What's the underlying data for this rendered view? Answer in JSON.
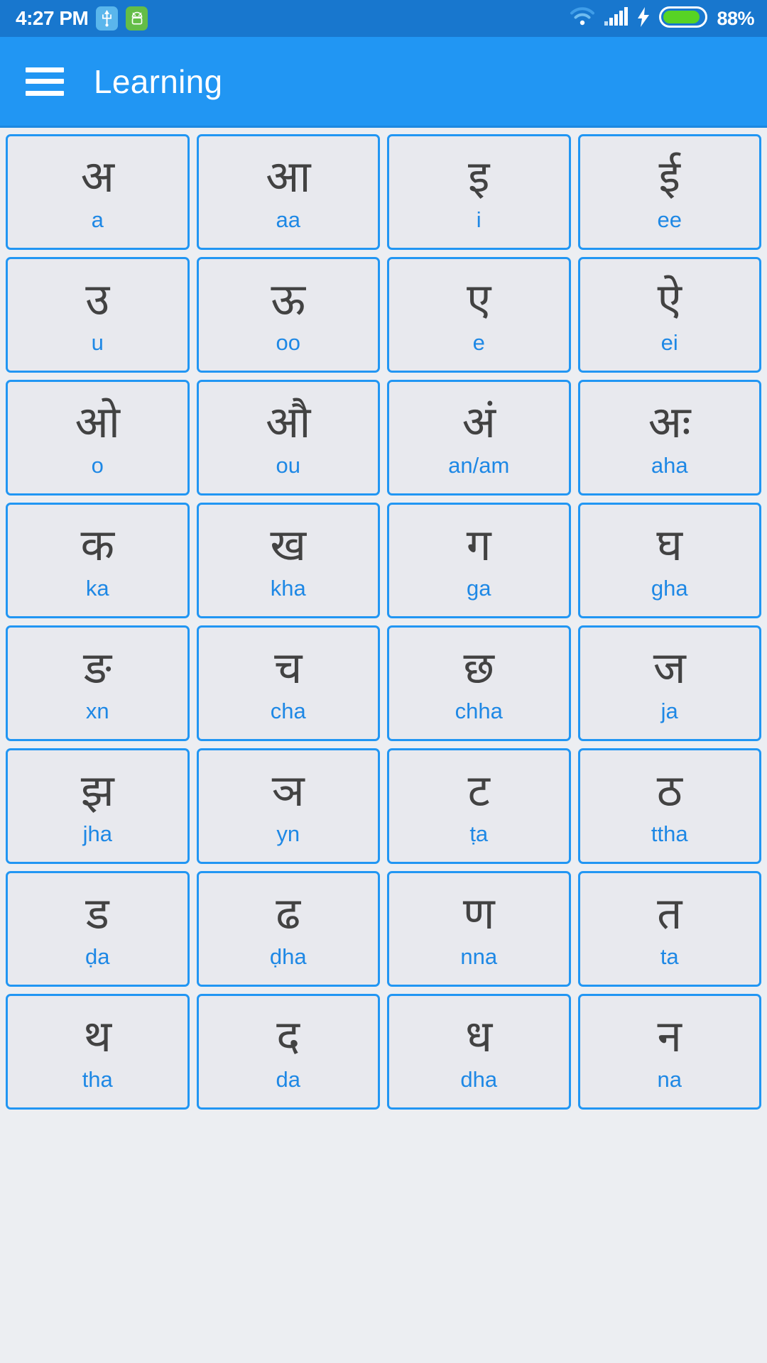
{
  "status_bar": {
    "time": "4:27 PM",
    "battery_percent": "88%",
    "icons": [
      "usb-icon",
      "android-icon",
      "wifi-icon",
      "signal-icon",
      "charging-bolt-icon",
      "battery-icon"
    ],
    "background_color": "#1877ce"
  },
  "app_bar": {
    "menu_icon": "hamburger-menu-icon",
    "title": "Learning",
    "background_color": "#2196f3"
  },
  "theme": {
    "accent": "#2196f3",
    "card_background": "#e8e9ee",
    "glyph_color": "#424242",
    "translit_color": "#1e88e5",
    "page_background": "#eceef2"
  },
  "grid": {
    "columns": 4,
    "cards": [
      {
        "glyph": "अ",
        "translit": "a"
      },
      {
        "glyph": "आ",
        "translit": "aa"
      },
      {
        "glyph": "इ",
        "translit": "i"
      },
      {
        "glyph": "ई",
        "translit": "ee"
      },
      {
        "glyph": "उ",
        "translit": "u"
      },
      {
        "glyph": "ऊ",
        "translit": "oo"
      },
      {
        "glyph": "ए",
        "translit": "e"
      },
      {
        "glyph": "ऐ",
        "translit": "ei"
      },
      {
        "glyph": "ओ",
        "translit": "o"
      },
      {
        "glyph": "औ",
        "translit": "ou"
      },
      {
        "glyph": "अं",
        "translit": "an/am"
      },
      {
        "glyph": "अः",
        "translit": "aha"
      },
      {
        "glyph": "क",
        "translit": "ka"
      },
      {
        "glyph": "ख",
        "translit": "kha"
      },
      {
        "glyph": "ग",
        "translit": "ga"
      },
      {
        "glyph": "घ",
        "translit": "gha"
      },
      {
        "glyph": "ङ",
        "translit": "xn"
      },
      {
        "glyph": "च",
        "translit": "cha"
      },
      {
        "glyph": "छ",
        "translit": "chha"
      },
      {
        "glyph": "ज",
        "translit": "ja"
      },
      {
        "glyph": "झ",
        "translit": "jha"
      },
      {
        "glyph": "ञ",
        "translit": "yn"
      },
      {
        "glyph": "ट",
        "translit": "ṭa"
      },
      {
        "glyph": "ठ",
        "translit": "ttha"
      },
      {
        "glyph": "ड",
        "translit": "ḍa"
      },
      {
        "glyph": "ढ",
        "translit": "ḍha"
      },
      {
        "glyph": "ण",
        "translit": "nna"
      },
      {
        "glyph": "त",
        "translit": "ta"
      },
      {
        "glyph": "थ",
        "translit": "tha"
      },
      {
        "glyph": "द",
        "translit": "da"
      },
      {
        "glyph": "ध",
        "translit": "dha"
      },
      {
        "glyph": "न",
        "translit": "na"
      }
    ]
  }
}
